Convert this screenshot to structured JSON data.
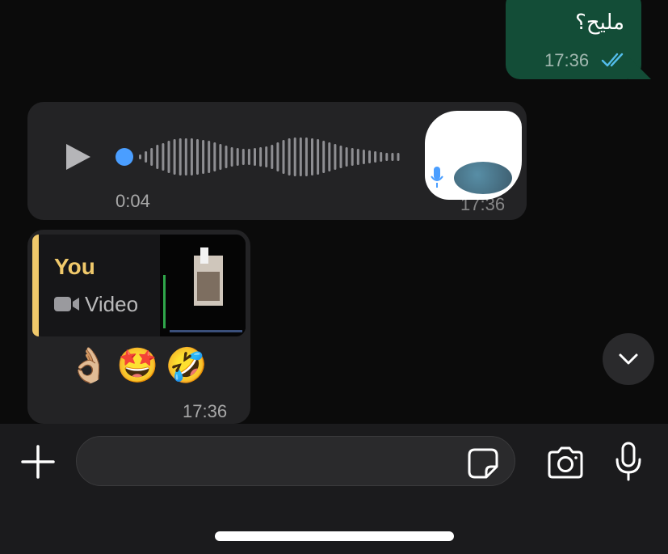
{
  "outgoing_message": {
    "text": "مليح؟",
    "time": "17:36",
    "status_icon": "double-check-read-icon"
  },
  "voice_message": {
    "duration": "0:04",
    "time": "17:36",
    "progress": 0.0,
    "play_icon": "play-icon"
  },
  "reply_message": {
    "quoted_sender": "You",
    "quoted_type": "Video",
    "quoted_icon": "video-camera-icon",
    "text": "👌🏼🤩🤣",
    "time": "17:36"
  },
  "composer": {
    "input_value": "",
    "placeholder": "",
    "icons": [
      "plus-icon",
      "sticker-icon",
      "camera-icon",
      "microphone-icon"
    ]
  },
  "colors": {
    "outgoing_bubble": "#134d37",
    "incoming_bubble": "#232325",
    "quote_accent": "#f0c96b",
    "read_ticks": "#53bdeb",
    "voice_dot": "#4a9eff"
  }
}
